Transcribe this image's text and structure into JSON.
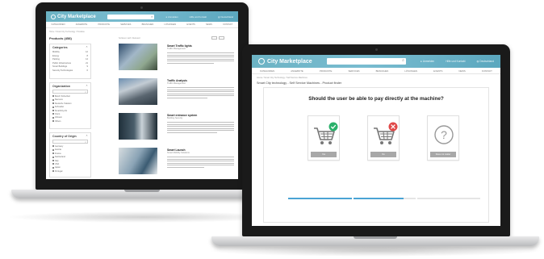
{
  "app": {
    "logo": "City Marketplace"
  },
  "left": {
    "header_items": [
      "Anmelden",
      "Hilfe und Kontakt",
      "Deutschland"
    ],
    "nav": [
      "Kategorien",
      "Angebote",
      "Produkte",
      "Services",
      "Branchen",
      "Lösungen",
      "Events",
      "News",
      "Kontakt"
    ],
    "breadcrumb": "Home / Smart City Technology / Produkte",
    "products_title": "Products (458)",
    "sort_label": "Sortieren nach: Relevanz",
    "categories": {
      "title": "Categories",
      "items": [
        "Mobility",
        "Energy",
        "Parking",
        "Public Infrastructure",
        "Smart Buildings",
        "Security Technologies"
      ],
      "counts": [
        "12",
        "8",
        "14",
        "21",
        "9",
        "6"
      ]
    },
    "organization": {
      "title": "Organization",
      "items": [
        "Bosch Sicherheit",
        "Siemens",
        "Deutsche Telekom",
        "Schneider",
        "SmartCity AG",
        "Cisco",
        "Infineon",
        "Others"
      ]
    },
    "country": {
      "title": "Country of Origin",
      "items": [
        "Germany",
        "Austria",
        "France",
        "Switzerland",
        "Italy",
        "USA",
        "Japan",
        "Portugal"
      ]
    },
    "results": [
      {
        "title": "Smart Traffic lights",
        "sub": "Traffic Management"
      },
      {
        "title": "Traffic Analysis",
        "sub": "Traffic Management"
      },
      {
        "title": "Smart entrance system",
        "sub": "Building Security"
      },
      {
        "title": "Smart Launch",
        "sub": "Smart Mobility Solutions"
      }
    ]
  },
  "right": {
    "header_items": [
      "Anmelden",
      "Hilfe und Kontakt",
      "Deutschland"
    ],
    "nav": [
      "Kategorien",
      "Angebote",
      "Produkte",
      "Services",
      "Branchen",
      "Lösungen",
      "Events",
      "News",
      "Kontakt"
    ],
    "breadcrumb": "Home / Smart City Technology / Self Service Machines",
    "page_title": "Smart City technology - Self Service Machines - Product finder",
    "question": "Should the user be able to pay directly at the machine?",
    "options": [
      {
        "label": "Yes",
        "icon": "cart-check-icon"
      },
      {
        "label": "No",
        "icon": "cart-cross-icon"
      },
      {
        "label": "Does not matter",
        "icon": "question-icon"
      }
    ],
    "progress_fraction": 0.6,
    "colors": {
      "accent": "#4aa4d4",
      "check": "#2ab06a",
      "cross": "#e04848",
      "header": "#6cb3c4"
    }
  }
}
